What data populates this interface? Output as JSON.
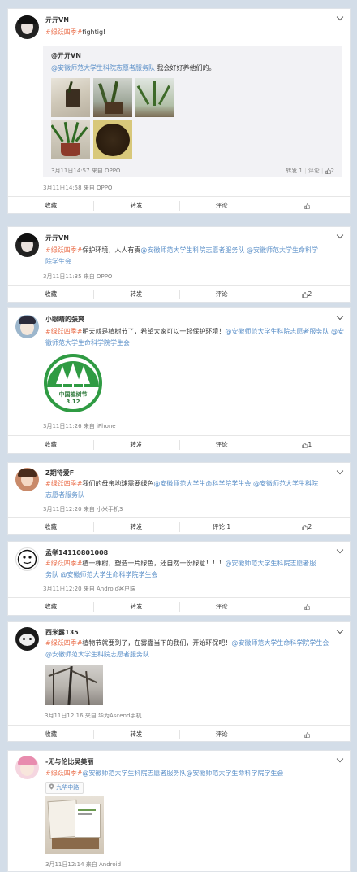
{
  "cards": [
    {
      "name": "亓亓VN",
      "topic": "#绿跃四季#",
      "text": "fightig!",
      "repost": {
        "name": "@亓亓VN",
        "at": "@安徽师范大学生科院志愿者服务队",
        "text": " 我会好好养他们的。",
        "meta": "3月11日14:57 来自 OPPO",
        "forward": "转发 1",
        "comment": "评论",
        "likes": "2"
      },
      "meta": "3月11日14:58 来自 OPPO",
      "actions": {
        "fav": "收藏",
        "forward": "转发",
        "comment": "评论",
        "likes": ""
      }
    },
    {
      "name": "亓亓VN",
      "topic": "#绿跃四季#",
      "text": "保护环境，人人有责",
      "at1": "@安徽师范大学生科院志愿者服务队",
      "at2": "@安徽师范大学生命科学",
      "line2": "院学生会",
      "meta": "3月11日11:35 来自 OPPO",
      "actions": {
        "fav": "收藏",
        "forward": "转发",
        "comment": "评论",
        "likes": "2"
      }
    },
    {
      "name": "小眼睛的張爽",
      "topic": "#绿跃四季#",
      "text": "明天就是植树节了，希望大家可以一起保护环境！",
      "at1": "@安徽师范大学生科院志愿者服务队",
      "at2": "@安",
      "line2": "徽师范大学生命科学院学生会",
      "logo_text": "中国植树节",
      "logo_date": "3.12",
      "meta": "3月11日11:26 来自 iPhone",
      "actions": {
        "fav": "收藏",
        "forward": "转发",
        "comment": "评论",
        "likes": "1"
      }
    },
    {
      "name": "Z期待爱F",
      "topic": "#绿跃四季#",
      "text": "我们的母亲地球需要绿色",
      "at1": "@安徽师范大学生命科学院学生会",
      "at2": "@安徽师范大学生科院",
      "line2": "志愿者服务队",
      "meta": "3月11日12:20 来自 小米手机3",
      "actions": {
        "fav": "收藏",
        "forward": "转发",
        "comment": "评论 1",
        "likes": "2"
      }
    },
    {
      "name": "孟举14110801008",
      "topic": "#绿跃四季#",
      "text": "植一棵树，塑造一片绿色，还自然一份绿意！！！",
      "at1": "@安徽师范大学生科院志愿者服",
      "line2a": "务队",
      "at2": "@安徽师范大学生命科学院学生会",
      "meta": "3月11日12:20 来自 Android客户端",
      "actions": {
        "fav": "收藏",
        "forward": "转发",
        "comment": "评论",
        "likes": ""
      }
    },
    {
      "name": "西米露135",
      "topic": "#绿跃四季#",
      "text": "植物节就要到了，在雾霾当下的我们，开始环保吧！",
      "at1": "@安徽师范大学生命科学院学生会",
      "at2": "@安徽师范大学生科院志愿者服务队",
      "meta": "3月11日12:16 来自 华为Ascend手机",
      "actions": {
        "fav": "收藏",
        "forward": "转发",
        "comment": "评论",
        "likes": ""
      }
    },
    {
      "name": "-无与伦比吴美丽",
      "topic": "#绿跃四季#",
      "at1": "@安徽师范大学生科院志愿者服务队",
      "at2": "@安徽师范大学生命科学院学生会",
      "location": "九华中路",
      "meta": "3月11日12:14 来自 Android"
    }
  ]
}
